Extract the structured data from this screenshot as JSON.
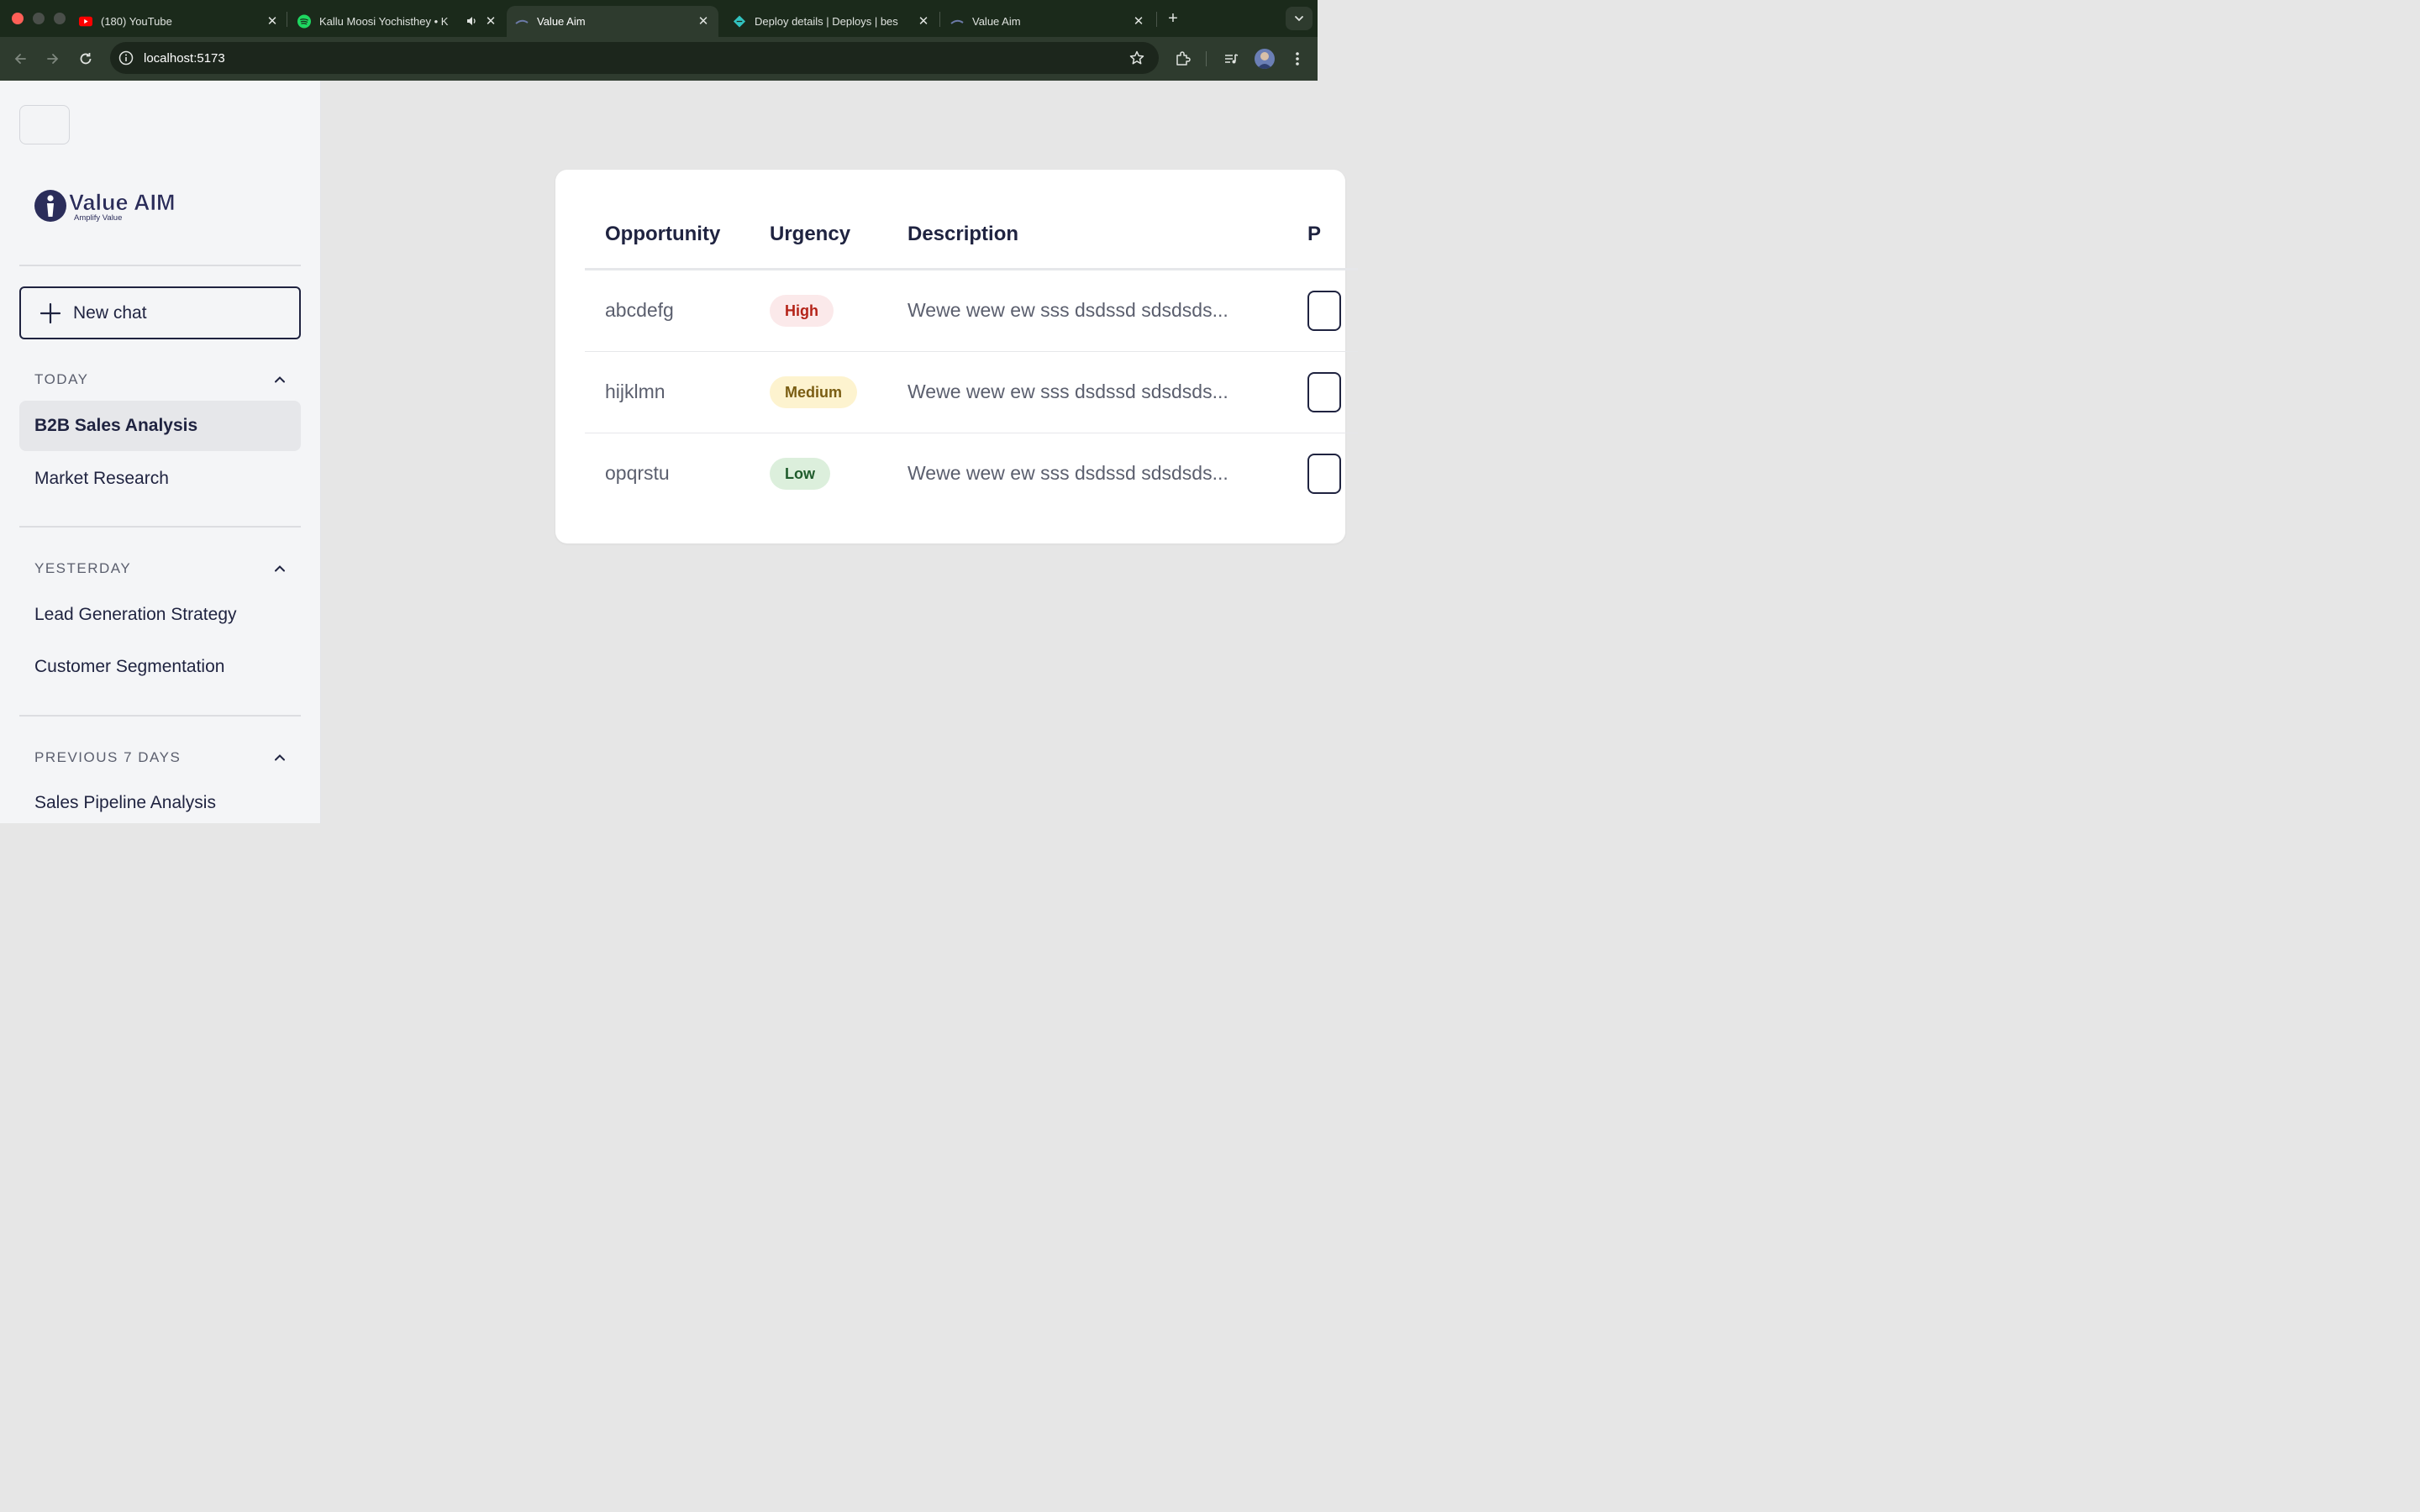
{
  "browser": {
    "tabs": [
      {
        "title": "(180) YouTube",
        "icon": "youtube-icon",
        "active": false
      },
      {
        "title": "Kallu Moosi Yochisthey • K",
        "icon": "spotify-icon",
        "active": false,
        "audio": true
      },
      {
        "title": "Value Aim",
        "icon": "value-aim-favicon",
        "active": true
      },
      {
        "title": "Deploy details | Deploys | bes",
        "icon": "netlify-icon",
        "active": false
      },
      {
        "title": "Value Aim",
        "icon": "value-aim-favicon",
        "active": false
      }
    ],
    "url": "localhost:5173"
  },
  "sidebar": {
    "logo": {
      "name": "Value AIM",
      "tagline": "Amplify Value"
    },
    "new_chat_label": "New chat",
    "sections": [
      {
        "label": "TODAY",
        "items": [
          "B2B Sales Analysis",
          "Market Research"
        ]
      },
      {
        "label": "YESTERDAY",
        "items": [
          "Lead Generation Strategy",
          "Customer Segmentation"
        ]
      },
      {
        "label": "PREVIOUS 7 DAYS",
        "items": [
          "Sales Pipeline Analysis"
        ]
      }
    ],
    "active_item": "B2B Sales Analysis"
  },
  "table": {
    "columns": [
      "Opportunity",
      "Urgency",
      "Description",
      "P"
    ],
    "rows": [
      {
        "opportunity": "abcdefg",
        "urgency": "High",
        "description": "Wewe wew ew sss dsdssd sdsdsds..."
      },
      {
        "opportunity": "hijklmn",
        "urgency": "Medium",
        "description": "Wewe wew ew sss dsdssd sdsdsds..."
      },
      {
        "opportunity": "opqrstu",
        "urgency": "Low",
        "description": "Wewe wew ew sss dsdssd sdsdsds..."
      }
    ]
  },
  "colors": {
    "chrome_dark": "#1b2a1b",
    "sidebar_bg": "#f4f5f7",
    "main_bg": "#e6e6e6",
    "text_primary": "#1f2340",
    "urgency_high": "#b42318",
    "urgency_medium": "#7a5d12",
    "urgency_low": "#1f5b2c"
  }
}
